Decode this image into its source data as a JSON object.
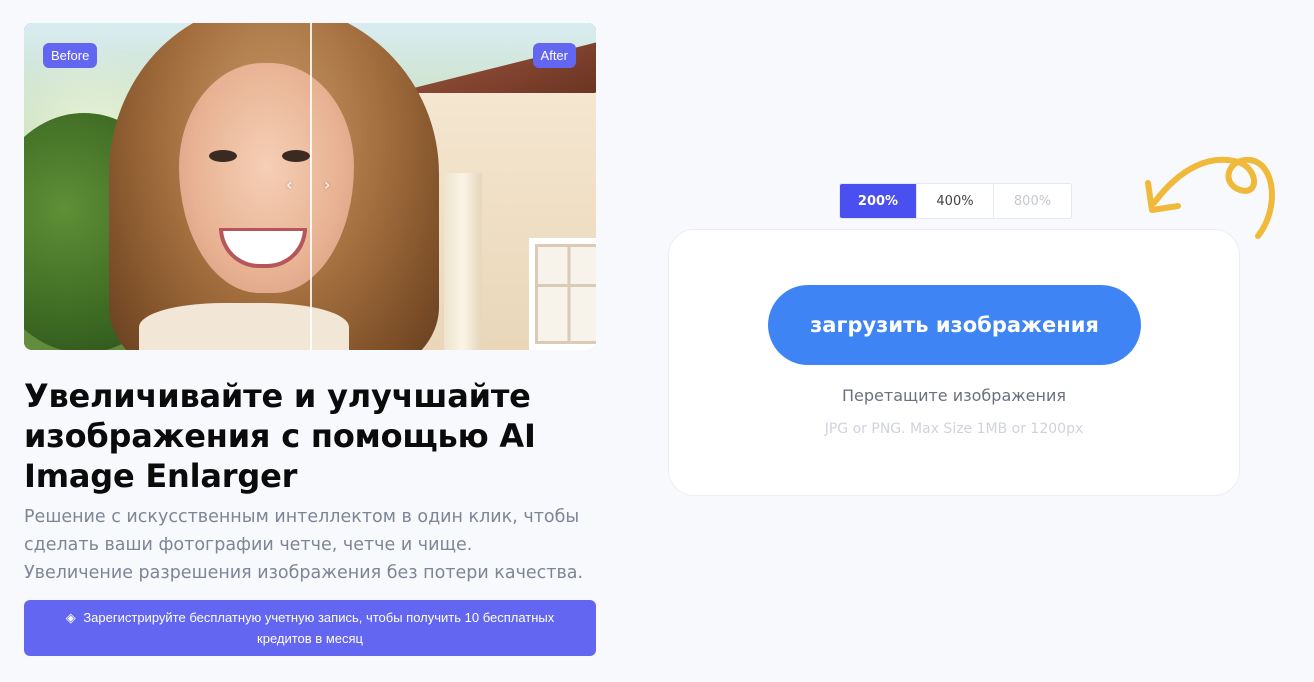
{
  "preview": {
    "before_label": "Before",
    "after_label": "After",
    "handle_left": "‹",
    "handle_right": "›"
  },
  "hero": {
    "headline": "Увеличивайте и улучшайте изображения с помощью AI Image Enlarger",
    "description": "Решение с искусственным интеллектом в один клик, чтобы сделать ваши фотографии четче, четче и чище. Увеличение разрешения изображения без потери качества.",
    "register_icon": "layers-icon",
    "register_label": "Зарегистрируйте бесплатную учетную запись, чтобы получить 10 бесплатных кредитов в месяц"
  },
  "scales": {
    "options": [
      "200%",
      "400%",
      "800%"
    ],
    "selected": "200%"
  },
  "upload": {
    "button_label": "загрузить изображения",
    "drag_text": "Перетащите изображения",
    "limits_text": "JPG or PNG. Max Size 1MB or 1200px"
  },
  "colors": {
    "accent_purple": "#6366f1",
    "upload_blue": "#3f84f5",
    "arrow_yellow": "#f0b93a",
    "background": "#f8f9fd"
  }
}
